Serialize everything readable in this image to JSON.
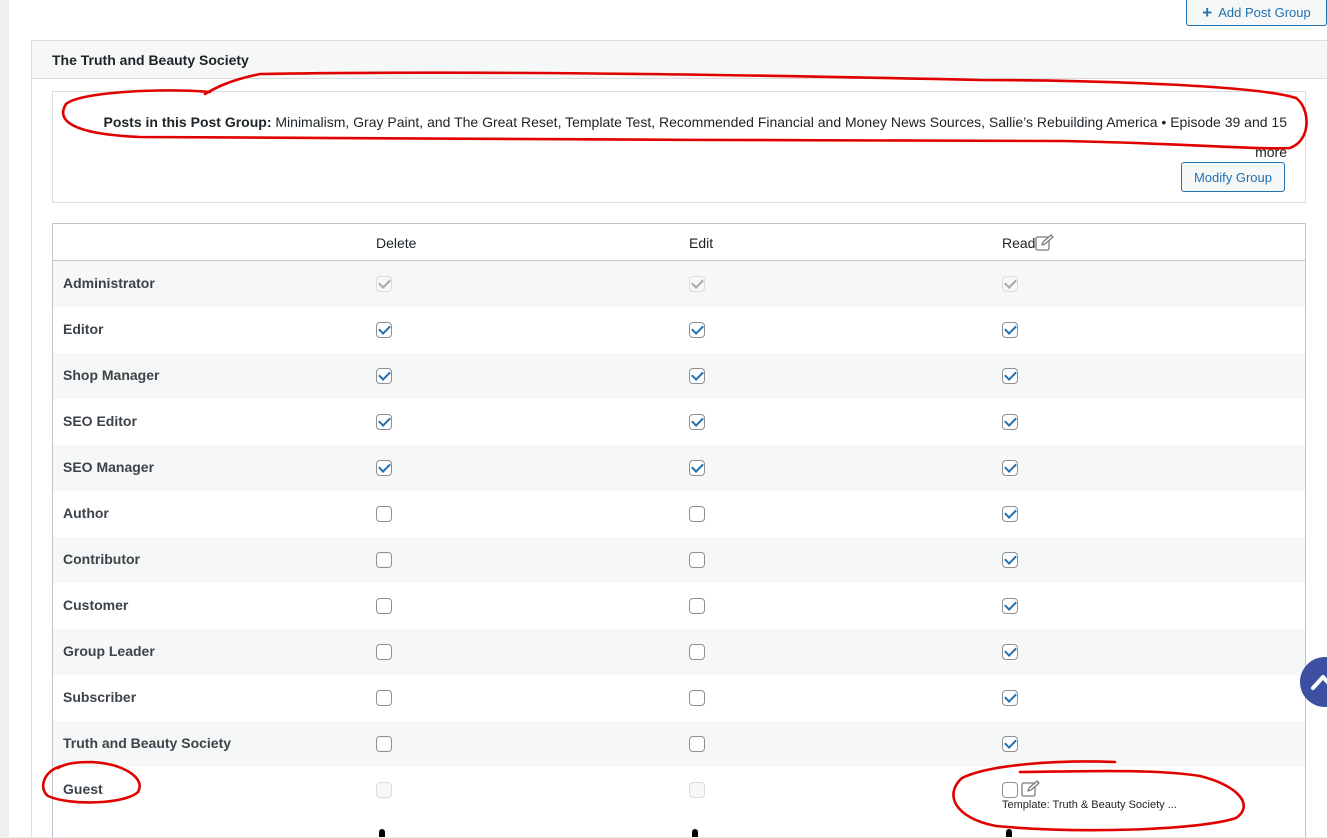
{
  "toolbar": {
    "add_post_group_label": "Add Post Group",
    "add_icon": "plus-icon"
  },
  "group": {
    "title": "The Truth and Beauty Society",
    "posts_label": "Posts in this Post Group:",
    "posts_list": "Minimalism, Gray Paint, and The Great Reset, Template Test, Recommended Financial and Money News Sources, Sallie’s Rebuilding America • Episode 39 and 15",
    "posts_more": "more",
    "modify_label": "Modify Group"
  },
  "table": {
    "columns": [
      "Delete",
      "Edit",
      "Read"
    ],
    "read_icon": "edit-pencil-icon",
    "rows": [
      {
        "role": "Administrator",
        "delete": true,
        "edit": true,
        "read": true,
        "disabled": true
      },
      {
        "role": "Editor",
        "delete": true,
        "edit": true,
        "read": true
      },
      {
        "role": "Shop Manager",
        "delete": true,
        "edit": true,
        "read": true
      },
      {
        "role": "SEO Editor",
        "delete": true,
        "edit": true,
        "read": true
      },
      {
        "role": "SEO Manager",
        "delete": true,
        "edit": true,
        "read": true
      },
      {
        "role": "Author",
        "delete": false,
        "edit": false,
        "read": true
      },
      {
        "role": "Contributor",
        "delete": false,
        "edit": false,
        "read": true
      },
      {
        "role": "Customer",
        "delete": false,
        "edit": false,
        "read": true
      },
      {
        "role": "Group Leader",
        "delete": false,
        "edit": false,
        "read": true
      },
      {
        "role": "Subscriber",
        "delete": false,
        "edit": false,
        "read": true
      },
      {
        "role": "Truth and Beauty Society",
        "delete": false,
        "edit": false,
        "read": true
      },
      {
        "role": "Guest",
        "delete": false,
        "edit": false,
        "read": false,
        "disabled_delete_edit": true
      }
    ],
    "guest_template": "Template: Truth & Beauty Society ..."
  },
  "colors": {
    "accent": "#2271b1",
    "annotation": "#e00000",
    "scroll_button": "#3c4fa0"
  },
  "scroll_top_icon": "chevron-up-icon"
}
